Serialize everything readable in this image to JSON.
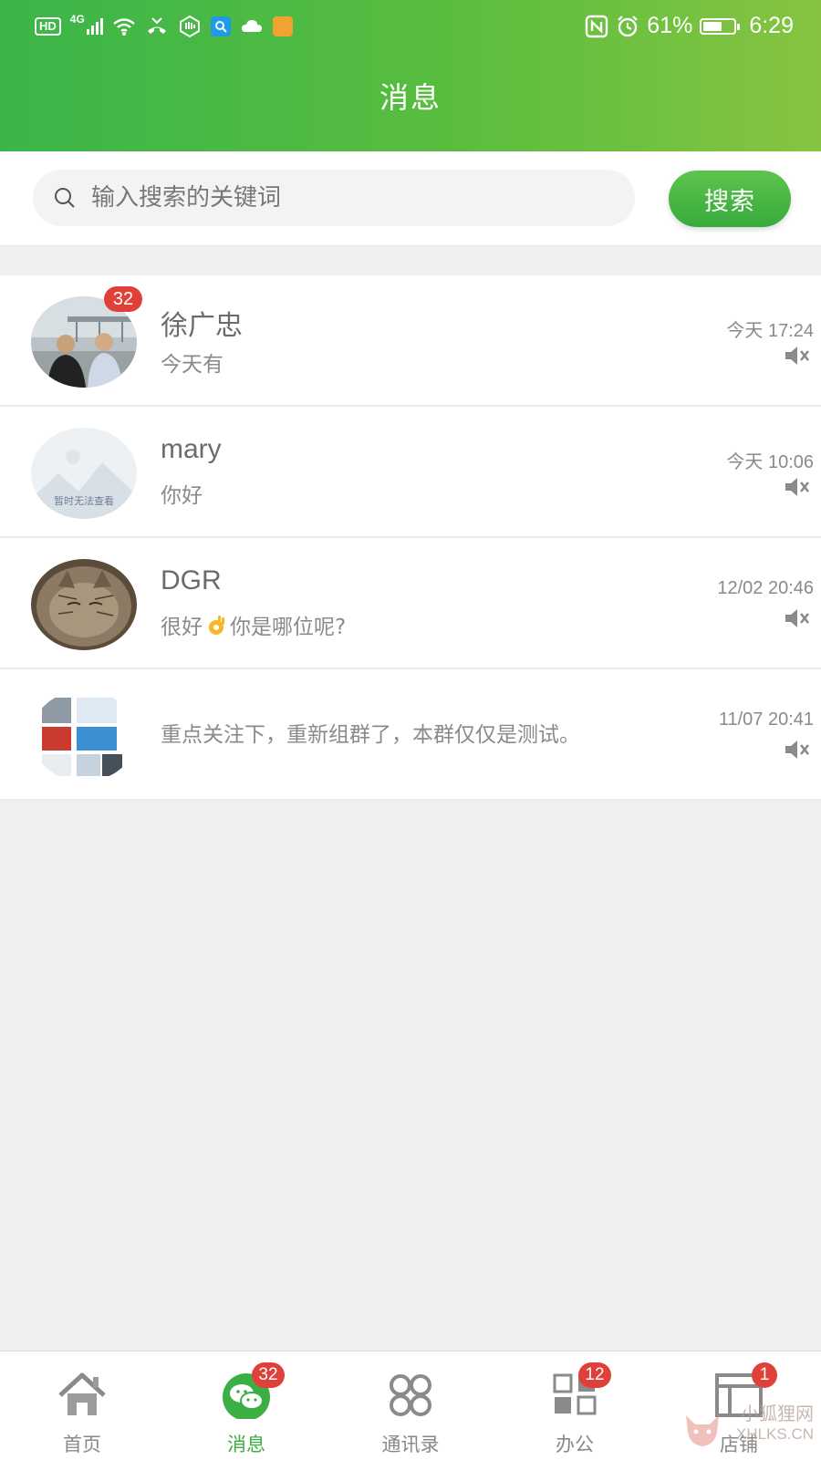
{
  "status_bar": {
    "network_label": "HD",
    "signal_label": "4G",
    "battery_percent": "61%",
    "battery_level": 0.61,
    "time": "6:29"
  },
  "header": {
    "title": "消息"
  },
  "search": {
    "placeholder": "输入搜索的关键词",
    "button_label": "搜索"
  },
  "chats": [
    {
      "name": "徐广忠",
      "preview": "今天有",
      "time": "今天 17:24",
      "unread": "32",
      "muted": true,
      "avatar": "photo-two-men"
    },
    {
      "name": "mary",
      "preview": "你好",
      "time": "今天 10:06",
      "avatar_text": "暂时无法查看",
      "muted": true,
      "avatar": "placeholder-landscape"
    },
    {
      "name": "DGR",
      "preview_before": "很好",
      "preview_after": "你是哪位呢?",
      "time": "12/02 20:46",
      "muted": true,
      "avatar": "photo-cat"
    },
    {
      "name": "",
      "preview": "重点关注下，重新组群了，本群仅仅是测试。",
      "time": "11/07 20:41",
      "muted": true,
      "avatar": "group-collage"
    }
  ],
  "bottom_nav": [
    {
      "label": "首页",
      "icon": "home-icon",
      "badge": ""
    },
    {
      "label": "消息",
      "icon": "chat-icon",
      "badge": "32",
      "active": true
    },
    {
      "label": "通讯录",
      "icon": "contacts-icon",
      "badge": ""
    },
    {
      "label": "办公",
      "icon": "office-icon",
      "badge": "12"
    },
    {
      "label": "店铺",
      "icon": "store-icon",
      "badge": "1"
    }
  ],
  "watermark": {
    "line1": "小狐狸网",
    "line2": "XHLKS.CN"
  },
  "colors": {
    "accent": "#3bb549",
    "badge": "#e0403a"
  }
}
